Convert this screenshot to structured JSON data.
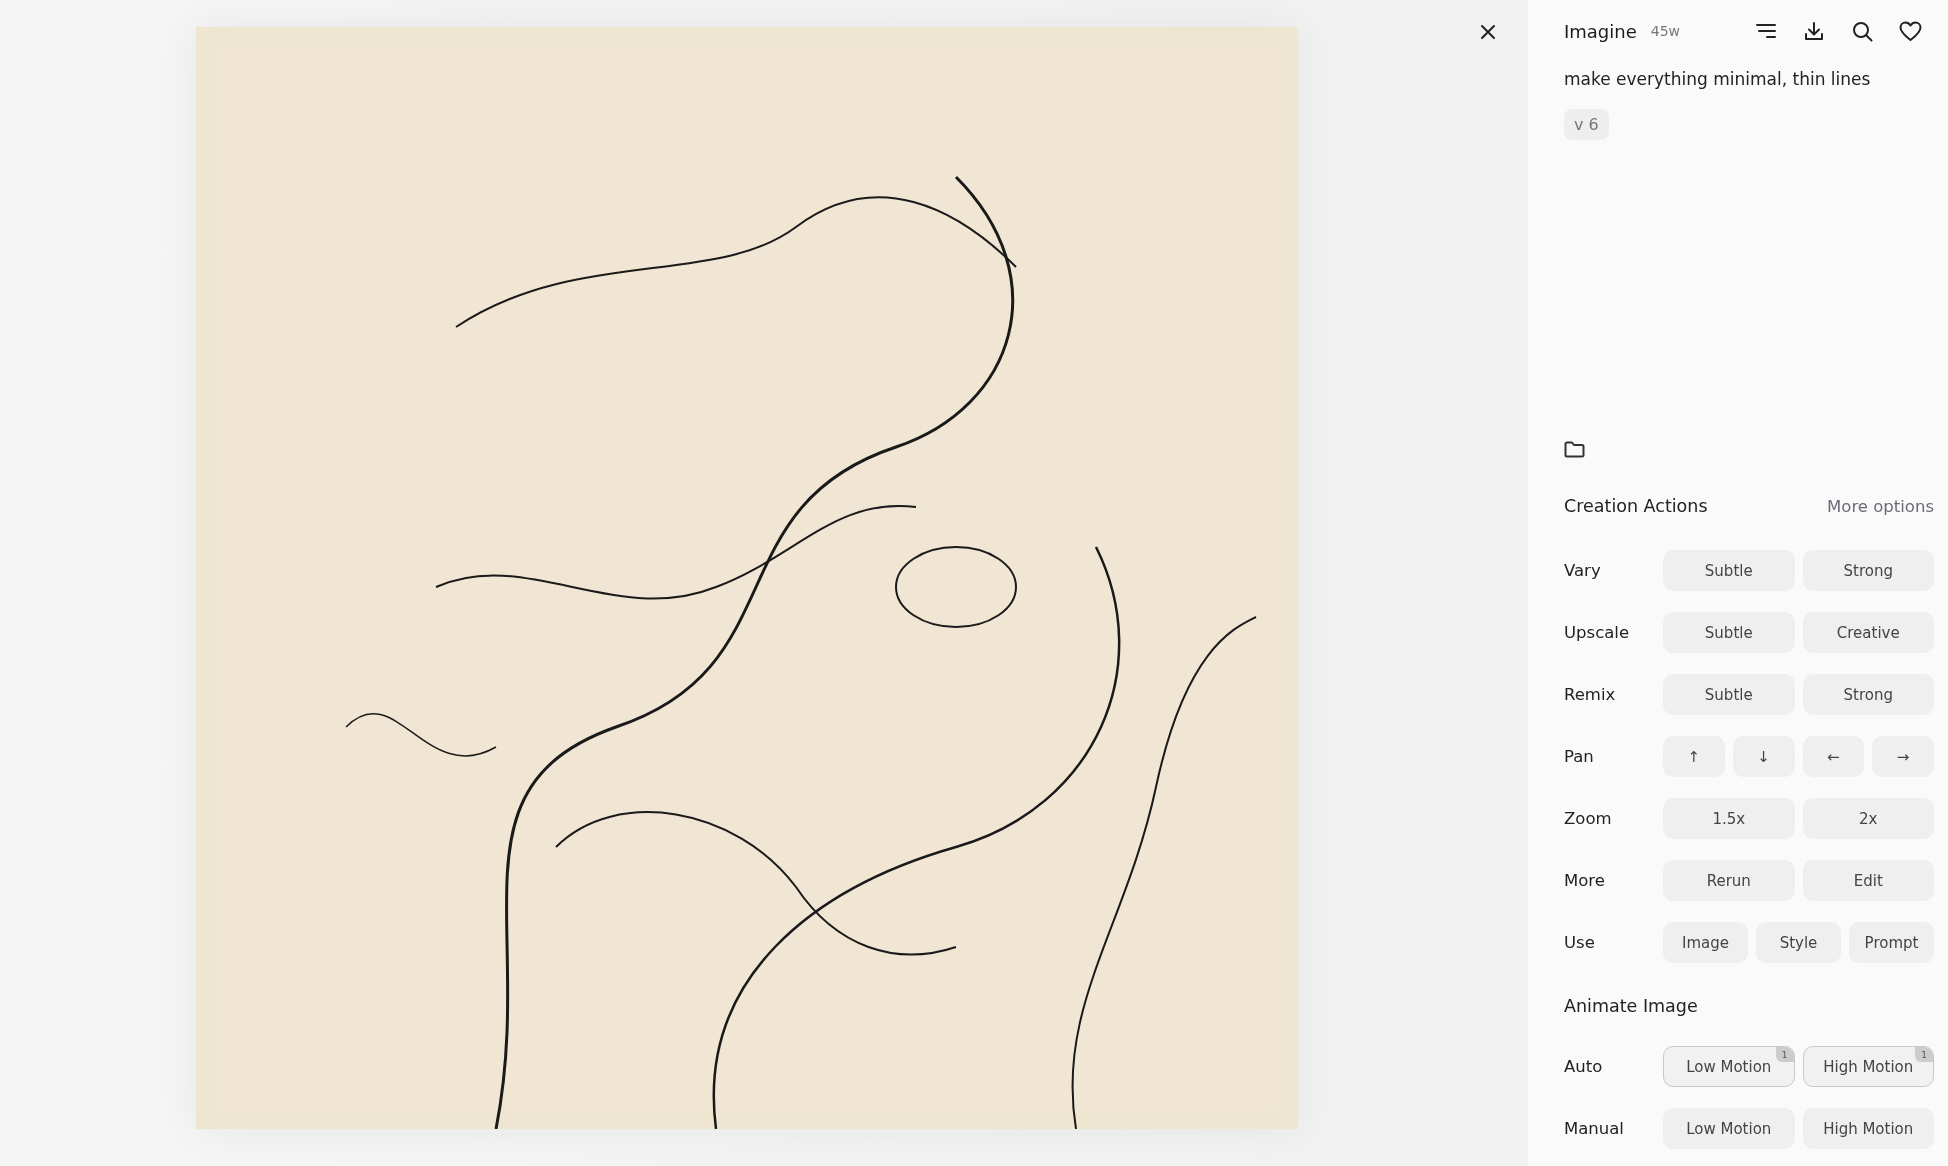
{
  "header": {
    "title": "Imagine",
    "age": "45w"
  },
  "prompt": "make everything minimal, thin lines",
  "version_tag": "v 6",
  "creation_actions": {
    "title": "Creation Actions",
    "more_link": "More options",
    "rows": [
      {
        "label": "Vary",
        "buttons": [
          {
            "label": "Subtle"
          },
          {
            "label": "Strong"
          }
        ]
      },
      {
        "label": "Upscale",
        "buttons": [
          {
            "label": "Subtle"
          },
          {
            "label": "Creative"
          }
        ]
      },
      {
        "label": "Remix",
        "buttons": [
          {
            "label": "Subtle"
          },
          {
            "label": "Strong"
          }
        ]
      },
      {
        "label": "Pan",
        "buttons": [
          {
            "label": "↑"
          },
          {
            "label": "↓"
          },
          {
            "label": "←"
          },
          {
            "label": "→"
          }
        ]
      },
      {
        "label": "Zoom",
        "buttons": [
          {
            "label": "1.5x"
          },
          {
            "label": "2x"
          }
        ]
      },
      {
        "label": "More",
        "buttons": [
          {
            "label": "Rerun"
          },
          {
            "label": "Edit"
          }
        ]
      },
      {
        "label": "Use",
        "buttons": [
          {
            "label": "Image"
          },
          {
            "label": "Style"
          },
          {
            "label": "Prompt"
          }
        ]
      }
    ]
  },
  "animate_image": {
    "title": "Animate Image",
    "rows": [
      {
        "label": "Auto",
        "buttons": [
          {
            "label": "Low Motion",
            "badge": "1"
          },
          {
            "label": "High Motion",
            "badge": "1"
          }
        ]
      },
      {
        "label": "Manual",
        "buttons": [
          {
            "label": "Low Motion"
          },
          {
            "label": "High Motion"
          }
        ]
      }
    ]
  }
}
